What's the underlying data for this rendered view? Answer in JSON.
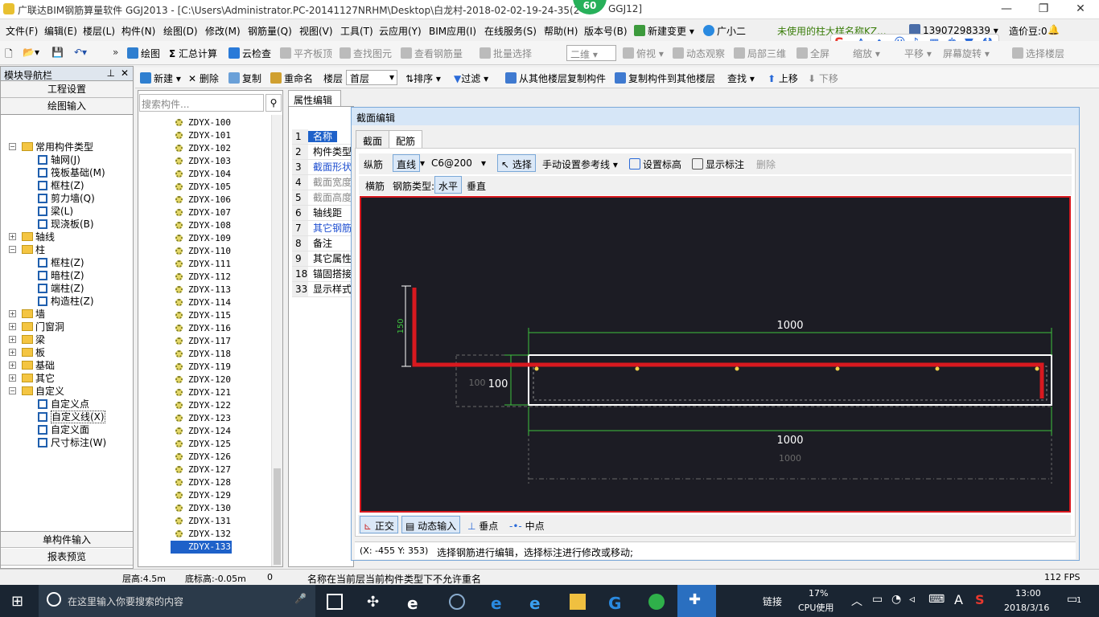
{
  "window": {
    "title": "广联达BIM钢筋算量软件 GGJ2013 - [C:\\Users\\Administrator.PC-20141127NRHM\\Desktop\\白龙村-2018-02-02-19-24-35(2",
    "title_suffix": "GGJ12]",
    "badge": "60",
    "min": "—",
    "max": "❐",
    "close": "✕"
  },
  "menu": {
    "items": [
      "文件(F)",
      "编辑(E)",
      "楼层(L)",
      "构件(N)",
      "绘图(D)",
      "修改(M)",
      "钢筋量(Q)",
      "视图(V)",
      "工具(T)",
      "云应用(Y)",
      "BIM应用(I)",
      "在线服务(S)",
      "帮助(H)",
      "版本号(B)"
    ],
    "new_change": "新建变更",
    "assistant": "广小二",
    "notice": "未使用的柱大样名称KZ...",
    "phone": "13907298339",
    "cost_beans": "造价豆:0"
  },
  "toolbar1": {
    "draw": "绘图",
    "sum": "汇总计算",
    "cloud_check": "云检查",
    "level_slab": "平齐板顶",
    "find_elem": "查找图元",
    "view_rebar": "查看钢筋量",
    "batch_select": "批量选择",
    "view_mode": "二维",
    "overlook": "俯视",
    "dyn_observe": "动态观察",
    "local_3d": "局部三维",
    "fullscreen": "全屏",
    "zoom": "缩放",
    "pan": "平移",
    "rotate": "屏幕旋转",
    "select_floor": "选择楼层"
  },
  "toolbar2": {
    "new": "新建",
    "delete": "删除",
    "copy": "复制",
    "rename": "重命名",
    "floor_label": "楼层",
    "floor_value": "首层",
    "sort": "排序",
    "filter": "过滤",
    "copy_from": "从其他楼层复制构件",
    "copy_to": "复制构件到其他楼层",
    "find": "查找",
    "move_up": "上移",
    "move_down": "下移"
  },
  "nav": {
    "title": "模块导航栏",
    "pin": "⊥",
    "close": "✕",
    "project_settings": "工程设置",
    "drawing_input": "绘图输入",
    "tree": [
      {
        "label": "常用构件类型",
        "level": 0,
        "expanded": true,
        "folder": true
      },
      {
        "label": "轴网(J)",
        "level": 1
      },
      {
        "label": "筏板基础(M)",
        "level": 1
      },
      {
        "label": "框柱(Z)",
        "level": 1
      },
      {
        "label": "剪力墙(Q)",
        "level": 1
      },
      {
        "label": "梁(L)",
        "level": 1
      },
      {
        "label": "现浇板(B)",
        "level": 1
      },
      {
        "label": "轴线",
        "level": 0,
        "expanded": false,
        "folder": true
      },
      {
        "label": "柱",
        "level": 0,
        "expanded": true,
        "folder": true
      },
      {
        "label": "框柱(Z)",
        "level": 1
      },
      {
        "label": "暗柱(Z)",
        "level": 1
      },
      {
        "label": "端柱(Z)",
        "level": 1
      },
      {
        "label": "构造柱(Z)",
        "level": 1
      },
      {
        "label": "墙",
        "level": 0,
        "expanded": false,
        "folder": true
      },
      {
        "label": "门窗洞",
        "level": 0,
        "expanded": false,
        "folder": true
      },
      {
        "label": "梁",
        "level": 0,
        "expanded": false,
        "folder": true
      },
      {
        "label": "板",
        "level": 0,
        "expanded": false,
        "folder": true
      },
      {
        "label": "基础",
        "level": 0,
        "expanded": false,
        "folder": true
      },
      {
        "label": "其它",
        "level": 0,
        "expanded": false,
        "folder": true
      },
      {
        "label": "自定义",
        "level": 0,
        "expanded": true,
        "folder": true
      },
      {
        "label": "自定义点",
        "level": 1
      },
      {
        "label": "自定义线(X)",
        "level": 1,
        "selected": true
      },
      {
        "label": "自定义面",
        "level": 1
      },
      {
        "label": "尺寸标注(W)",
        "level": 1
      }
    ],
    "single_input": "单构件输入",
    "report": "报表预览"
  },
  "list": {
    "search_placeholder": "搜索构件...",
    "items": [
      "ZDYX-100",
      "ZDYX-101",
      "ZDYX-102",
      "ZDYX-103",
      "ZDYX-104",
      "ZDYX-105",
      "ZDYX-106",
      "ZDYX-107",
      "ZDYX-108",
      "ZDYX-109",
      "ZDYX-110",
      "ZDYX-111",
      "ZDYX-112",
      "ZDYX-113",
      "ZDYX-114",
      "ZDYX-115",
      "ZDYX-116",
      "ZDYX-117",
      "ZDYX-118",
      "ZDYX-119",
      "ZDYX-120",
      "ZDYX-121",
      "ZDYX-122",
      "ZDYX-123",
      "ZDYX-124",
      "ZDYX-125",
      "ZDYX-126",
      "ZDYX-127",
      "ZDYX-128",
      "ZDYX-129",
      "ZDYX-130",
      "ZDYX-131",
      "ZDYX-132",
      "ZDYX-133"
    ],
    "selected": "ZDYX-133"
  },
  "props": {
    "tab": "属性编辑",
    "rows": [
      {
        "n": "1",
        "label": "名称"
      },
      {
        "n": "2",
        "label": "构件类型"
      },
      {
        "n": "3",
        "label": "截面形状"
      },
      {
        "n": "4",
        "label": "截面宽度"
      },
      {
        "n": "5",
        "label": "截面高度"
      },
      {
        "n": "6",
        "label": "轴线距"
      },
      {
        "n": "7",
        "label": "其它钢筋"
      },
      {
        "n": "8",
        "label": "备注"
      },
      {
        "n": "9",
        "label": "其它属性"
      },
      {
        "n": "18",
        "label": "锚固搭接"
      },
      {
        "n": "33",
        "label": "显示样式"
      }
    ]
  },
  "dialog": {
    "title": "截面编辑",
    "tabs": [
      "截面",
      "配筋"
    ],
    "active_tab": "配筋",
    "longi": "纵筋",
    "line_mode": "直线",
    "rebar_spec": "C6@200",
    "select": "选择",
    "manual_ref": "手动设置参考线",
    "set_elev": "设置标高",
    "show_dim": "显示标注",
    "delete": "删除",
    "transverse": "横筋",
    "rebar_type_label": "钢筋类型:",
    "horizontal": "水平",
    "vertical": "垂直",
    "dims": {
      "top": "1000",
      "bottom": "1000",
      "bottom_gray": "1000",
      "left": "100",
      "left_gray": "100",
      "vert": "150"
    },
    "ortho": "正交",
    "dyn_input": "动态输入",
    "perp_point": "垂点",
    "mid_point": "中点",
    "coords": "(X: -455 Y: 353)",
    "hint": "选择钢筋进行编辑，选择标注进行修改或移动;"
  },
  "statusbar": {
    "floor_h": "层高:4.5m",
    "base_elev": "底标高:-0.05m",
    "zero": "0",
    "msg": "名称在当前层当前构件类型下不允许重名",
    "fps": "112 FPS"
  },
  "taskbar": {
    "search": "在这里输入你要搜索的内容",
    "link": "链接",
    "cpu_pct": "17%",
    "cpu_label": "CPU使用",
    "ime": "A",
    "time": "13:00",
    "date": "2018/3/16",
    "notif": "1"
  },
  "colors": {
    "accent": "#1e61c9",
    "rebar": "#d8191f",
    "dim": "#3ec23e",
    "canvas_bg": "#1c1c24"
  }
}
